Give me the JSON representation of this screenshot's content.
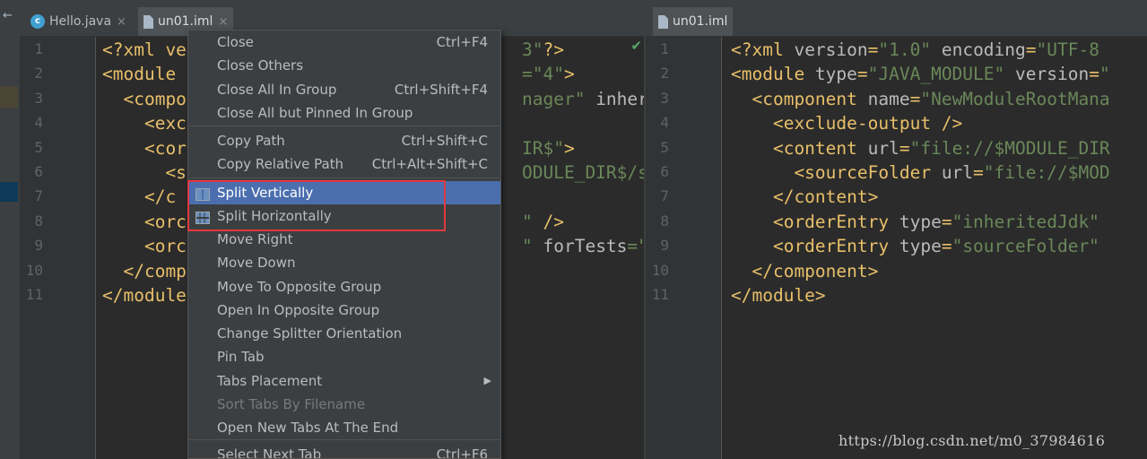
{
  "left_pane": {
    "tabs": [
      {
        "label": "Hello.java",
        "icon": "java-class-icon",
        "close": "×"
      },
      {
        "label": "un01.iml",
        "icon": "file-icon",
        "close": "×"
      }
    ],
    "line_numbers": [
      "1",
      "2",
      "3",
      "4",
      "5",
      "6",
      "7",
      "8",
      "9",
      "10",
      "11"
    ],
    "inspection_mark": "✔",
    "code_visible": [
      [
        "<?xml ve",
        "",
        "",
        ""
      ],
      [
        "<module ",
        "",
        "",
        ""
      ],
      [
        "  <compo",
        "",
        "",
        ""
      ],
      [
        "    <exc",
        "",
        "",
        ""
      ],
      [
        "    <cor",
        "",
        "",
        ""
      ],
      [
        "      <s",
        "",
        "",
        ""
      ],
      [
        "    </c",
        "",
        "",
        ""
      ],
      [
        "    <orc",
        "",
        "",
        ""
      ],
      [
        "    <orc",
        "",
        "",
        ""
      ],
      [
        "  </comp",
        "",
        "",
        ""
      ],
      [
        "</module",
        "",
        "",
        ""
      ]
    ],
    "code_tail": [
      "3\"?>",
      "=\"4\">",
      "nager\" inheri",
      "",
      "IR$\">",
      "ODULE_DIR$/sr",
      "",
      "\" />",
      "\" forTests=\"f",
      "",
      ""
    ]
  },
  "right_pane": {
    "tabs": [
      {
        "label": "un01.iml",
        "icon": "file-icon"
      }
    ],
    "line_numbers": [
      "1",
      "2",
      "3",
      "4",
      "5",
      "6",
      "7",
      "8",
      "9",
      "10",
      "11"
    ],
    "code": [
      [
        "<?xml ",
        "version",
        "=",
        "\"1.0\"",
        " ",
        "encoding",
        "=",
        "\"UTF-8"
      ],
      [
        "<module ",
        "type",
        "=",
        "\"JAVA_MODULE\"",
        " ",
        "version",
        "=",
        "\""
      ],
      [
        "  <component ",
        "name",
        "=",
        "\"NewModuleRootMana",
        "",
        "",
        "",
        ""
      ],
      [
        "    <exclude-output />",
        "",
        "",
        "",
        "",
        "",
        "",
        ""
      ],
      [
        "    <content ",
        "url",
        "=",
        "\"file://$MODULE_DIR",
        "",
        "",
        "",
        ""
      ],
      [
        "      <sourceFolder ",
        "url",
        "=",
        "\"file://$MOD",
        "",
        "",
        "",
        ""
      ],
      [
        "    </content>",
        "",
        "",
        "",
        "",
        "",
        "",
        ""
      ],
      [
        "    <orderEntry ",
        "type",
        "=",
        "\"inheritedJdk\"",
        " ",
        "",
        "",
        ""
      ],
      [
        "    <orderEntry ",
        "type",
        "=",
        "\"sourceFolder\"",
        " ",
        "",
        "",
        ""
      ],
      [
        "  </component>",
        "",
        "",
        "",
        "",
        "",
        "",
        ""
      ],
      [
        "</module>",
        "",
        "",
        "",
        "",
        "",
        "",
        ""
      ]
    ]
  },
  "context_menu": {
    "items": [
      {
        "label": "Close",
        "shortcut": "Ctrl+F4"
      },
      {
        "label": "Close Others",
        "shortcut": ""
      },
      {
        "label": "Close All In Group",
        "shortcut": "Ctrl+Shift+F4"
      },
      {
        "label": "Close All but Pinned In Group",
        "shortcut": ""
      },
      {
        "label": "Copy Path",
        "shortcut": "Ctrl+Shift+C"
      },
      {
        "label": "Copy Relative Path",
        "shortcut": "Ctrl+Alt+Shift+C"
      },
      {
        "label": "Split Vertically",
        "shortcut": "",
        "icon": "split-vertically-icon",
        "selected": true
      },
      {
        "label": "Split Horizontally",
        "shortcut": "",
        "icon": "split-horizontally-icon"
      },
      {
        "label": "Move Right",
        "shortcut": ""
      },
      {
        "label": "Move Down",
        "shortcut": ""
      },
      {
        "label": "Move To Opposite Group",
        "shortcut": ""
      },
      {
        "label": "Open In Opposite Group",
        "shortcut": ""
      },
      {
        "label": "Change Splitter Orientation",
        "shortcut": ""
      },
      {
        "label": "Pin Tab",
        "shortcut": ""
      },
      {
        "label": "Tabs Placement",
        "shortcut": "",
        "submenu": true
      },
      {
        "label": "Sort Tabs By Filename",
        "shortcut": "",
        "disabled": true
      },
      {
        "label": "Open New Tabs At The End",
        "shortcut": ""
      },
      {
        "label": "Select Next Tab",
        "shortcut": "Ctrl+F6"
      }
    ]
  },
  "watermark": "https://blog.csdn.net/m0_37984616",
  "colors": {
    "menu_selected": "#4b6eaf",
    "highlight_box": "#e0393e",
    "string": "#6a8759",
    "tag": "#e8bf6a"
  }
}
